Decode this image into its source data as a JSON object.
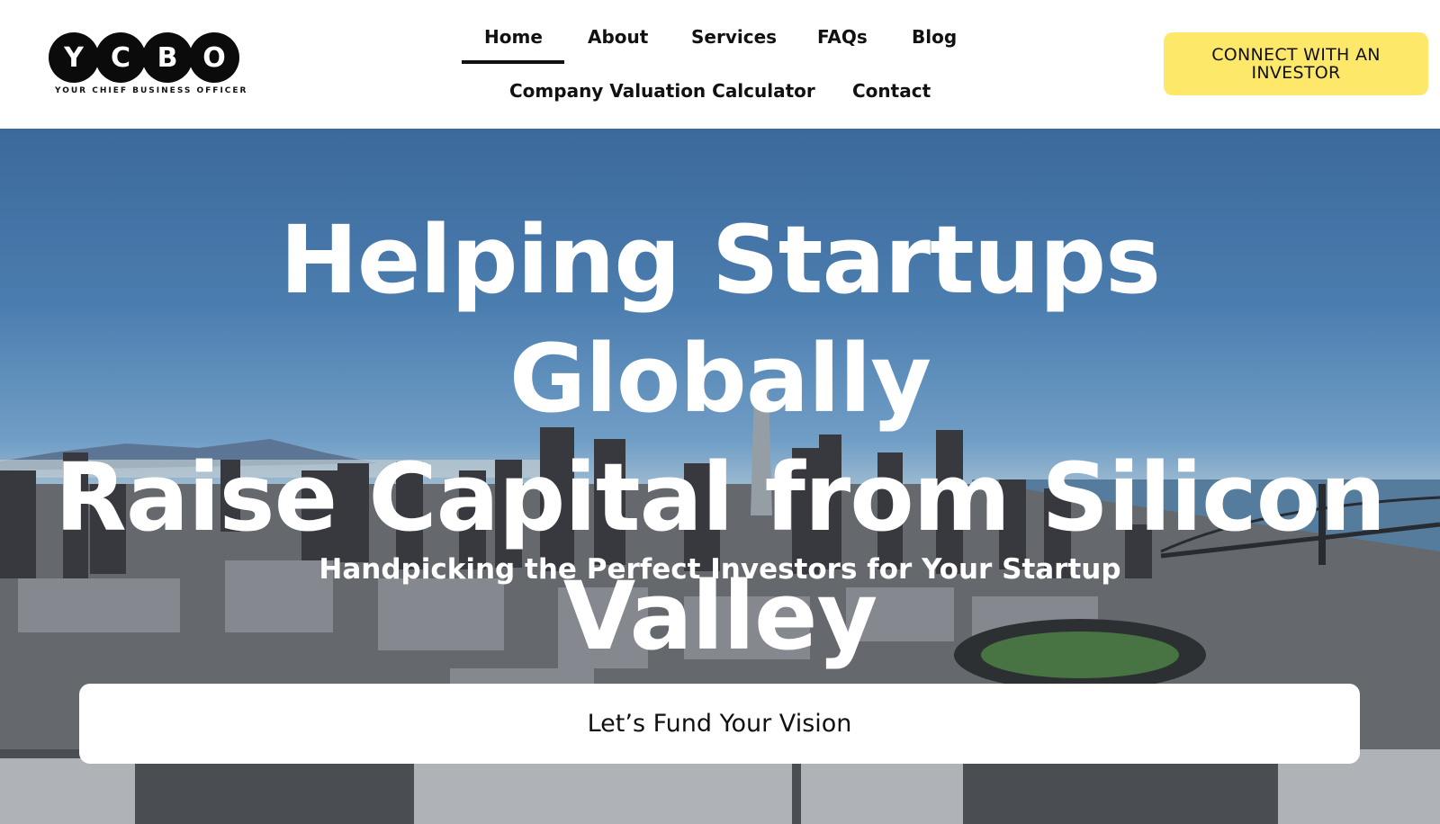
{
  "header": {
    "logo": {
      "letters": [
        "Y",
        "C",
        "B",
        "O"
      ],
      "tagline": "YOUR CHIEF BUSINESS OFFICER"
    },
    "nav": {
      "home": "Home",
      "about": "About",
      "services": "Services",
      "faqs": "FAQs",
      "blog": "Blog",
      "calculator": "Company Valuation Calculator",
      "contact": "Contact",
      "active": "Home"
    },
    "cta": {
      "line1": "CONNECT WITH AN",
      "line2": "INVESTOR",
      "color": "#fde86a"
    }
  },
  "hero": {
    "title_line1": "Helping Startups Globally",
    "title_line2": "Raise Capital from Silicon",
    "title_line3": "Valley",
    "subtitle": "Handpicking the Perfect Investors for Your Startup",
    "button_label": "Let’s Fund Your Vision",
    "background": "aerial city skyline photo with bay bridge"
  }
}
